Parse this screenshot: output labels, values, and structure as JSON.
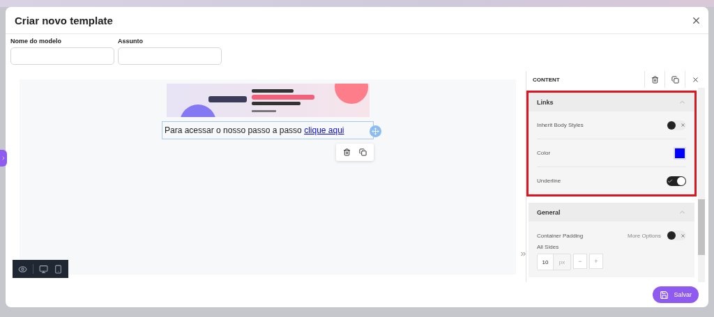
{
  "dialog": {
    "title": "Criar novo template"
  },
  "fields": [
    {
      "label": "Nome do modelo"
    },
    {
      "label": "Assunto"
    }
  ],
  "canvas": {
    "text_block": {
      "text": "Para acessar o nosso passo a passo ",
      "link": "clique aqui",
      "selected": true
    }
  },
  "panel": {
    "title": "CONTENT",
    "sections": [
      {
        "title": "Links",
        "expanded": true,
        "highlighted": true,
        "rows": [
          {
            "kind": "toggle",
            "label": "Inherit Body Styles",
            "on": false
          },
          {
            "kind": "color",
            "label": "Color",
            "color": "#0000ff"
          },
          {
            "kind": "toggle",
            "label": "Underline",
            "on": true
          }
        ]
      },
      {
        "title": "General",
        "expanded": true,
        "highlighted": false,
        "rows": [
          {
            "kind": "padding",
            "label": "Container Padding",
            "option_label": "More Options",
            "on": false,
            "sub_label": "All Sides",
            "value": "10",
            "unit": "px",
            "decrement": "−",
            "increment": "+"
          }
        ]
      }
    ]
  },
  "save_button": "Salvar"
}
